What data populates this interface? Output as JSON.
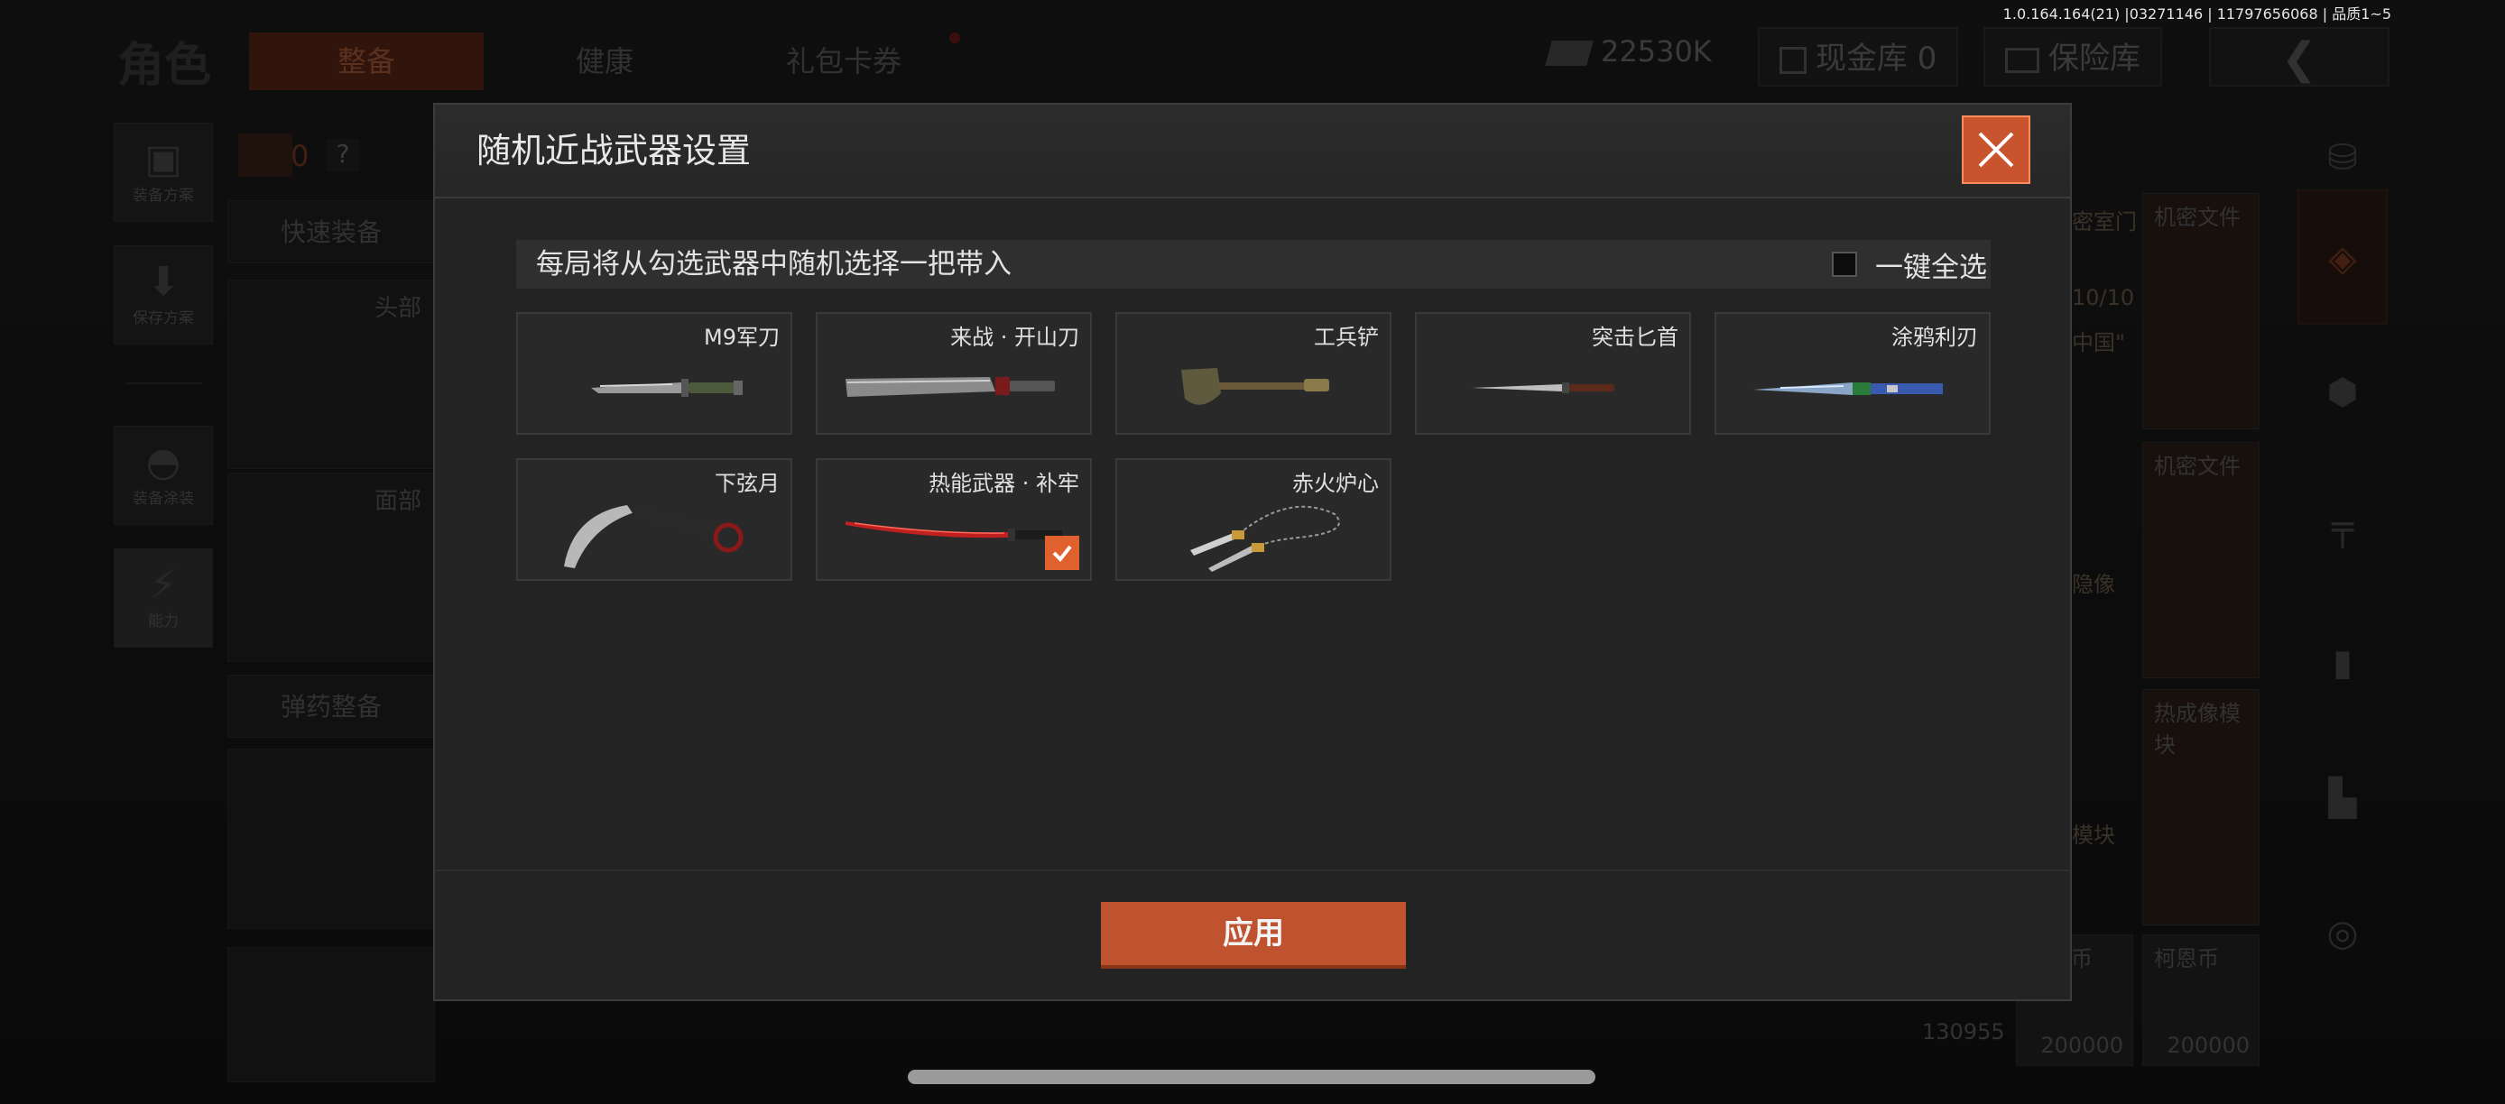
{
  "status_bar": {
    "version": "1.0.164.164(21) |03271146 | 11797656068 | 品质1~5"
  },
  "background": {
    "page_title": "角色",
    "tabs": [
      "整备",
      "健康",
      "礼包卡券"
    ],
    "currency": "22530K",
    "cash_vault": "现金库 0",
    "safe_box": "保险库",
    "side_buttons": [
      "装备方案",
      "保存方案",
      "装备涂装",
      "能力"
    ],
    "quick_equip": "快速装备",
    "ammo_setup": "弹药整备",
    "head_label": "头部",
    "face_label": "面部",
    "bag_count": "0",
    "right_cards": [
      "机密文件",
      "机密文件",
      "热成像模块",
      "柯恩币",
      "柯恩币"
    ],
    "card_values": [
      "130955",
      "200000",
      "200000"
    ],
    "partial_labels": [
      "密室门",
      "10/10",
      "中国\"",
      "隐像",
      "模块"
    ]
  },
  "modal": {
    "title": "随机近战武器设置",
    "instruction": "每局将从勾选武器中随机选择一把带入",
    "select_all_label": "一键全选",
    "weapons": [
      {
        "name": "M9军刀",
        "icon": "combat-knife-icon",
        "checked": false
      },
      {
        "name": "来战 · 开山刀",
        "icon": "machete-icon",
        "checked": false
      },
      {
        "name": "工兵铲",
        "icon": "shovel-icon",
        "checked": false
      },
      {
        "name": "突击匕首",
        "icon": "dagger-icon",
        "checked": false
      },
      {
        "name": "涂鸦利刃",
        "icon": "graffiti-blade-icon",
        "checked": false
      },
      {
        "name": "下弦月",
        "icon": "karambit-icon",
        "checked": false
      },
      {
        "name": "热能武器 · 补牢",
        "icon": "thermal-katana-icon",
        "checked": true
      },
      {
        "name": "赤火炉心",
        "icon": "chain-blades-icon",
        "checked": false
      }
    ],
    "apply_label": "应用"
  },
  "colors": {
    "accent": "#c9532c",
    "check": "#e0602e",
    "panel": "#232323"
  }
}
